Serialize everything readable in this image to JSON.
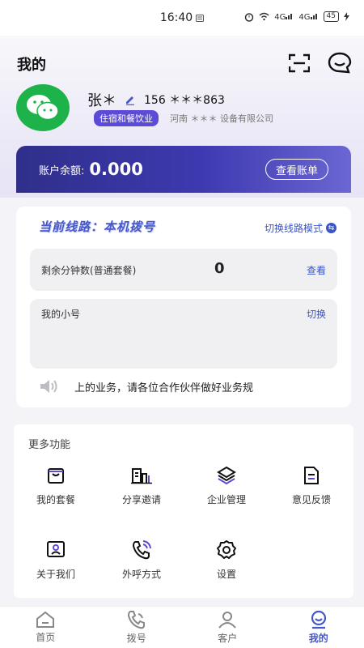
{
  "status_bar": {
    "time": "16:40",
    "signal_a": "4G",
    "signal_b": "4G",
    "battery": "45"
  },
  "header": {
    "title": "我的"
  },
  "profile": {
    "name": "张＊",
    "phone": "156 ＊＊＊863",
    "tag": "住宿和餐饮业",
    "company": "河南 ＊＊＊ 设备有限公司"
  },
  "account": {
    "balance_label": "账户余额:",
    "balance_value": "0.000",
    "bill_button": "查看账单"
  },
  "line": {
    "current_label": "当前线路：本机拨号",
    "switch_mode": "切换线路模式",
    "minutes_label": "剩余分钟数(普通套餐)",
    "minutes_value": "0",
    "minutes_link": "查看",
    "sub_label": "我的小号",
    "sub_link": "切换",
    "notice": "上的业务，请各位合作伙伴做好业务规"
  },
  "functions": {
    "title": "更多功能",
    "items": [
      {
        "label": "我的套餐",
        "icon": "package-icon"
      },
      {
        "label": "分享邀请",
        "icon": "share-icon"
      },
      {
        "label": "企业管理",
        "icon": "layers-icon"
      },
      {
        "label": "意见反馈",
        "icon": "feedback-icon"
      },
      {
        "label": "关于我们",
        "icon": "about-icon"
      },
      {
        "label": "外呼方式",
        "icon": "phone-call-icon"
      },
      {
        "label": "设置",
        "icon": "gear-icon"
      }
    ]
  },
  "nav": {
    "items": [
      {
        "label": "首页",
        "icon": "home-icon"
      },
      {
        "label": "拨号",
        "icon": "dial-icon"
      },
      {
        "label": "客户",
        "icon": "customer-icon"
      },
      {
        "label": "我的",
        "icon": "me-icon"
      }
    ],
    "active": "我的"
  },
  "colors": {
    "accent": "#4657c9",
    "card_gradient_start": "#2f2f8a",
    "card_gradient_end": "#6a66d2",
    "avatar_green": "#1db34a"
  }
}
